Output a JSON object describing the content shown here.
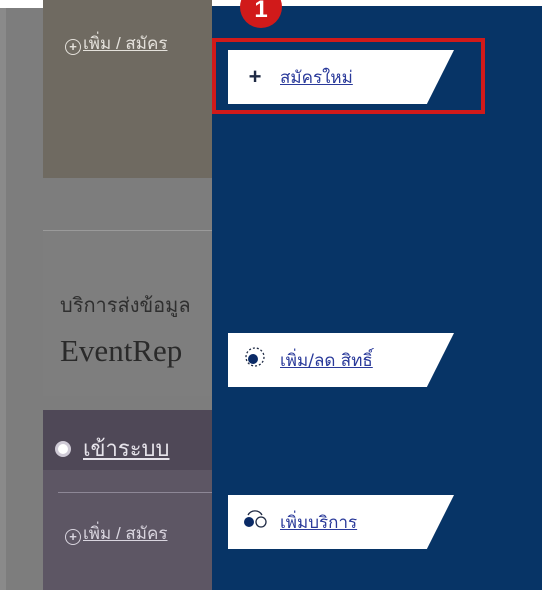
{
  "background": {
    "card1_link": "เพิ่ม / สมัคร",
    "card2_subtitle": "บริการส่งข้อมูล",
    "card2_title": "EventRep",
    "card3_login": "เข้าระบบ",
    "card3_link": "เพิ่ม / สมัคร"
  },
  "step_badge": "1",
  "menu": {
    "items": [
      {
        "label": "สมัครใหม่",
        "icon": "plus-icon"
      },
      {
        "label": "เพิ่ม/ลด สิทธิ์",
        "icon": "dotted-circle-icon"
      },
      {
        "label": "เพิ่มบริการ",
        "icon": "add-service-icon"
      }
    ]
  },
  "colors": {
    "panel": "#073466",
    "highlight": "#d11a1a",
    "link": "#2a3a9a"
  }
}
